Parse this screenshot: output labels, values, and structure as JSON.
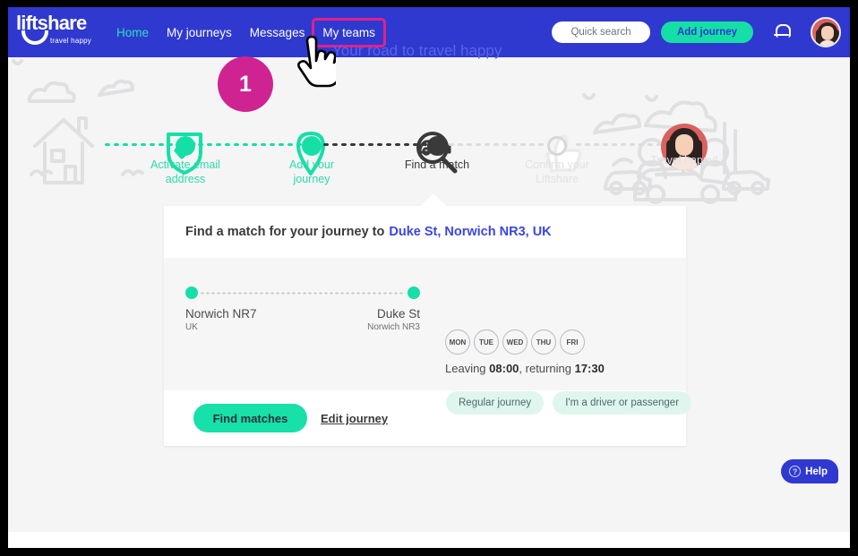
{
  "brand": {
    "name": "liftshare",
    "tagline": "travel happy",
    "header_bg": "#2f39cf",
    "accent_green": "#15dfa7",
    "accent_pink": "#cf2391",
    "link_blue": "#3b46e0"
  },
  "header": {
    "nav": [
      {
        "label": "Home",
        "state": "active"
      },
      {
        "label": "My journeys",
        "state": "default"
      },
      {
        "label": "Messages",
        "state": "default"
      },
      {
        "label": "My teams",
        "state": "highlighted"
      }
    ],
    "quick_search_label": "Quick search",
    "add_journey_label": "Add journey",
    "bell_icon": "notification-bell-icon",
    "avatar_icon": "user-avatar"
  },
  "annotation": {
    "step_number": "1",
    "cursor_icon": "pointing-hand-cursor"
  },
  "road": {
    "title": "Your road to travel happy",
    "steps": [
      {
        "label": "Activate email\naddress",
        "label_line1": "Activate email",
        "label_line2": "address",
        "state": "done",
        "icon": "shield-check-icon"
      },
      {
        "label": "Add your\njourney",
        "label_line1": "Add your",
        "label_line2": "journey",
        "state": "done",
        "icon": "map-pin-plus-icon"
      },
      {
        "label": "Find a match",
        "label_line1": "Find a match",
        "label_line2": "",
        "state": "current",
        "icon": "car-search-icon"
      },
      {
        "label": "Confirm your\nLiftshare",
        "label_line1": "Confirm your",
        "label_line2": "Liftshare",
        "state": "future",
        "icon": "thumbs-up-icon"
      },
      {
        "label": "Travel happy!",
        "label_line1": "Travel happy!",
        "label_line2": "",
        "state": "future",
        "icon": "people-car-icon"
      }
    ]
  },
  "card": {
    "heading_prefix": "Find a match for your journey to",
    "destination": "Duke St, Norwich NR3, UK",
    "route": {
      "origin_main": "Norwich NR7",
      "origin_sub": "UK",
      "dest_main": "Duke St",
      "dest_sub": "Norwich NR3"
    },
    "days": [
      "MON",
      "TUE",
      "WED",
      "THU",
      "FRI"
    ],
    "schedule": {
      "leaving_prefix": "Leaving ",
      "leaving_time": "08:00",
      "returning_prefix": ", returning ",
      "returning_time": "17:30"
    },
    "chips": [
      "Regular journey",
      "I'm a driver or passenger"
    ],
    "find_matches_label": "Find matches",
    "edit_journey_label": "Edit journey"
  },
  "help": {
    "label": "Help",
    "icon": "question-mark-icon"
  }
}
